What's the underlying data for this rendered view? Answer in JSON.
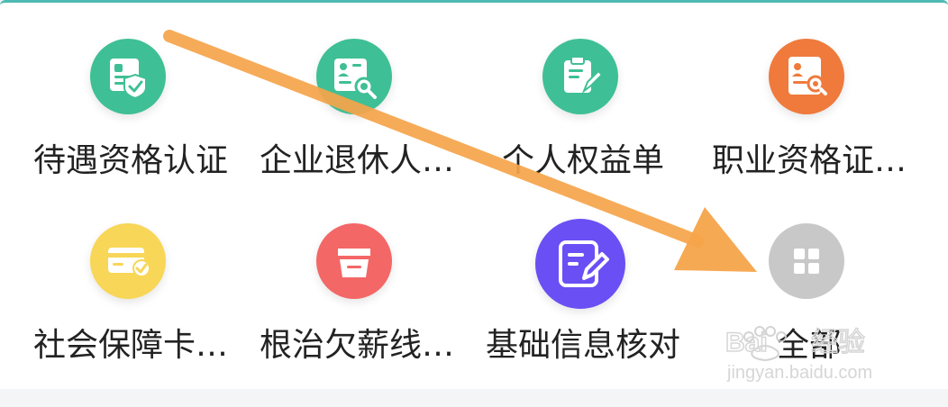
{
  "colors": {
    "teal": "#3fbf95",
    "orange": "#ef7a3c",
    "yellow": "#f8d657",
    "red": "#f36766",
    "purple": "#6a4ff4",
    "gray": "#c8c8c8",
    "arrow": "#f6a44a",
    "card_border": "#4fb9b3"
  },
  "services": [
    {
      "label": "待遇资格认证",
      "icon": "id-card-check-icon",
      "color": "teal"
    },
    {
      "label": "企业退休人…",
      "icon": "person-card-search-icon",
      "color": "teal"
    },
    {
      "label": "个人权益单",
      "icon": "clipboard-edit-icon",
      "color": "teal"
    },
    {
      "label": "职业资格证…",
      "icon": "certificate-search-icon",
      "color": "orange"
    },
    {
      "label": "社会保障卡…",
      "icon": "card-check-icon",
      "color": "yellow"
    },
    {
      "label": "根治欠薪线…",
      "icon": "inbox-tray-icon",
      "color": "red"
    },
    {
      "label": "基础信息核对",
      "icon": "edit-document-icon",
      "color": "purple"
    },
    {
      "label": "全部",
      "icon": "grid-icon",
      "color": "gray"
    }
  ]
}
